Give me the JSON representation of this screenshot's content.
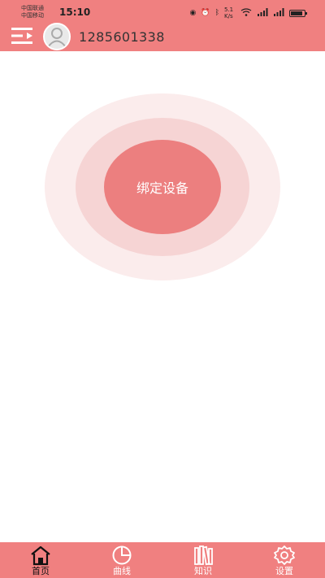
{
  "status_bar": {
    "carrier_1": "中国联通",
    "carrier_2": "中国移动",
    "time": "15:10",
    "net_speed": "5.1 K/s"
  },
  "header": {
    "account": "1285601338",
    "menu_icon": "menu-list-icon",
    "avatar_icon": "user-avatar-icon",
    "color": "#f08080"
  },
  "main": {
    "bind_button_label": "绑定设备",
    "colors": {
      "outer": "#fbecec",
      "middle": "#f6d4d4",
      "inner": "#ec7f7f"
    }
  },
  "bottom_nav": {
    "items": [
      {
        "label": "首页",
        "icon": "home-icon",
        "active": true
      },
      {
        "label": "曲线",
        "icon": "pie-chart-icon",
        "active": false
      },
      {
        "label": "知识",
        "icon": "books-icon",
        "active": false
      },
      {
        "label": "设置",
        "icon": "gear-icon",
        "active": false
      }
    ]
  }
}
